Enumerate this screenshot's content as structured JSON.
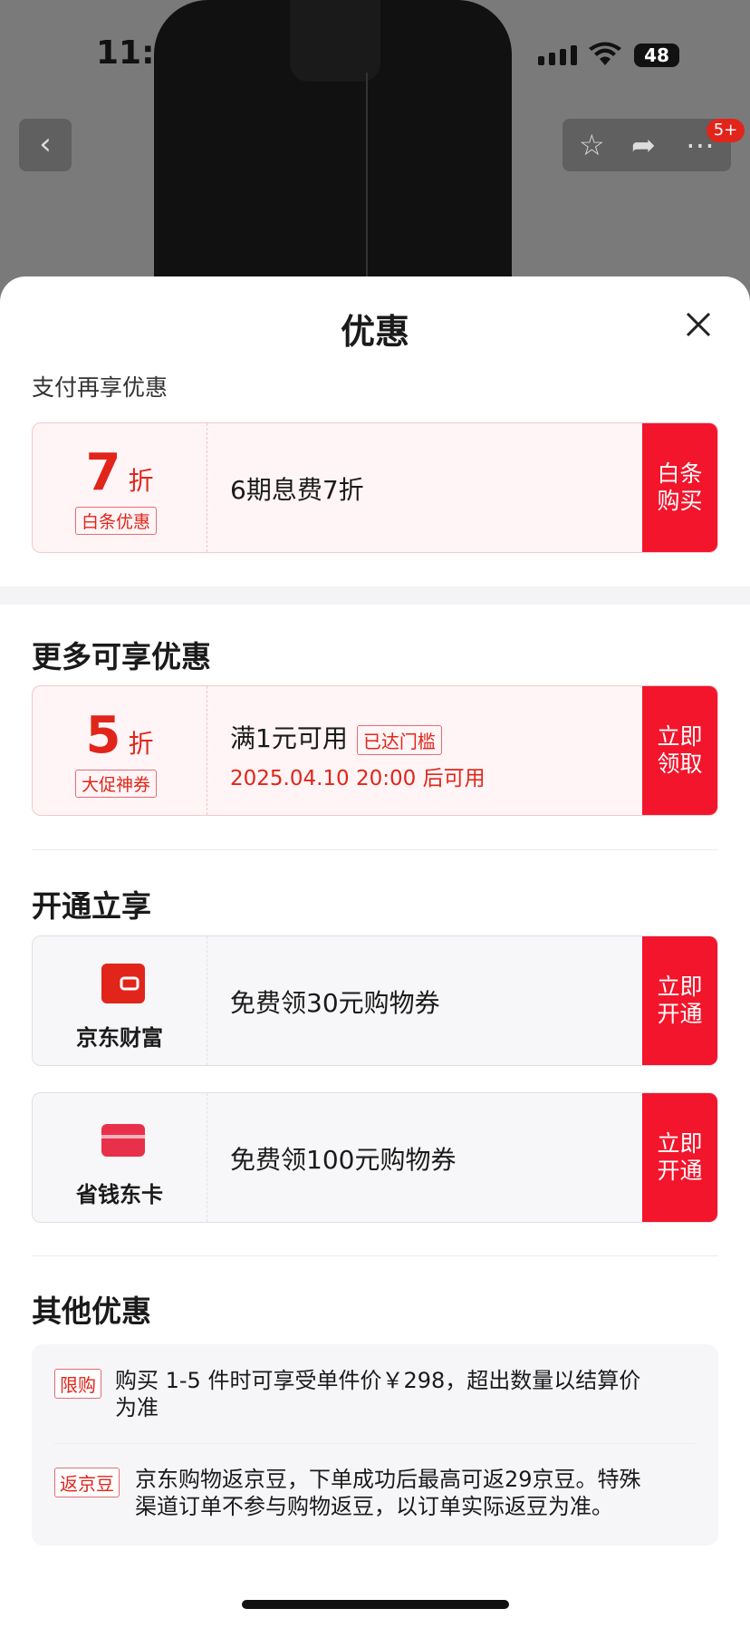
{
  "status": {
    "time": "11:30",
    "battery": "48"
  },
  "nav": {
    "badge": "5+"
  },
  "sheet": {
    "title": "优惠",
    "pay_label": "支付再享优惠",
    "baitiao": {
      "num": "7",
      "unit": "折",
      "tag": "白条优惠",
      "text": "6期息费7折",
      "action_line1": "白条",
      "action_line2": "购买"
    },
    "more_title": "更多可享优惠",
    "coupon": {
      "num": "5",
      "unit": "折",
      "tag": "大促神券",
      "text": "满1元可用",
      "reached": "已达门槛",
      "time": "2025.04.10 20:00 后可用",
      "action_line1": "立即",
      "action_line2": "领取"
    },
    "open_title": "开通立享",
    "open_items": [
      {
        "brand": "京东财富",
        "text": "免费领30元购物券",
        "action_line1": "立即",
        "action_line2": "开通",
        "icon": "wallet-icon"
      },
      {
        "brand": "省钱东卡",
        "text": "免费领100元购物券",
        "action_line1": "立即",
        "action_line2": "开通",
        "icon": "card-icon"
      }
    ],
    "other_title": "其他优惠",
    "other_items": [
      {
        "tag": "限购",
        "line1": "购买 1-5 件时可享受单件价￥298，超出数量以结算价",
        "line2": "为准"
      },
      {
        "tag": "返京豆",
        "line1": "京东购物返京豆，下单成功后最高可返29京豆。特殊",
        "line2": "渠道订单不参与购物返豆，以订单实际返豆为准。"
      }
    ]
  },
  "colors": {
    "accent": "#e1251b",
    "button": "#f2152b"
  }
}
